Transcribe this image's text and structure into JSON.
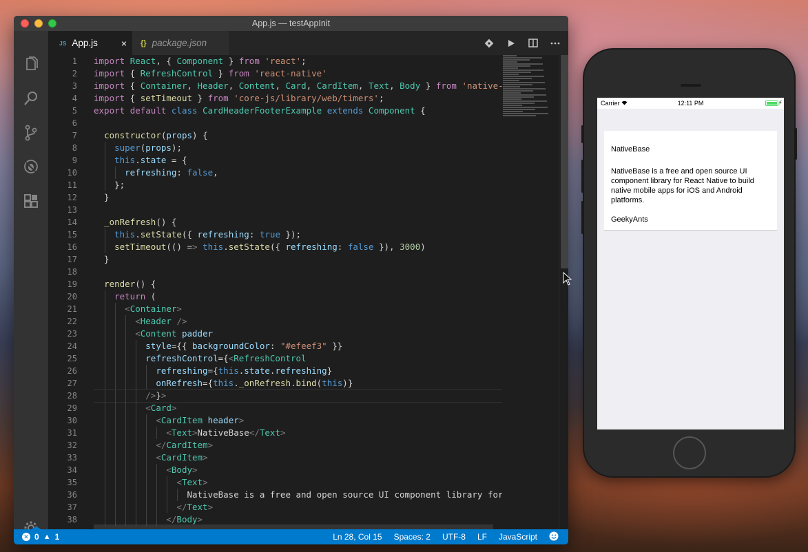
{
  "window": {
    "title": "App.js — testAppInit"
  },
  "tabs": [
    {
      "icon": "JS",
      "label": "App.js",
      "close": "×"
    },
    {
      "icon": "{}",
      "label": "package.json"
    }
  ],
  "activity_badge": "1",
  "line_numbers": [
    "1",
    "2",
    "3",
    "4",
    "5",
    "6",
    "7",
    "8",
    "9",
    "10",
    "11",
    "12",
    "13",
    "14",
    "15",
    "16",
    "17",
    "18",
    "19",
    "20",
    "21",
    "22",
    "23",
    "24",
    "25",
    "26",
    "27",
    "28",
    "29",
    "30",
    "31",
    "32",
    "33",
    "34",
    "35",
    "36",
    "37",
    "38"
  ],
  "code": [
    "import React, { Component } from 'react';",
    "import { RefreshControl } from 'react-native'",
    "import { Container, Header, Content, Card, CardItem, Text, Body } from 'native-bas",
    "import { setTimeout } from 'core-js/library/web/timers';",
    "export default class CardHeaderFooterExample extends Component {",
    "",
    "  constructor(props) {",
    "    super(props);",
    "    this.state = {",
    "      refreshing: false,",
    "    };",
    "  }",
    "",
    "  _onRefresh() {",
    "    this.setState({ refreshing: true });",
    "    setTimeout(() => this.setState({ refreshing: false }), 3000)",
    "  }",
    "",
    "  render() {",
    "    return (",
    "      <Container>",
    "        <Header />",
    "        <Content padder",
    "          style={{ backgroundColor: \"#efeef3\" }}",
    "          refreshControl={<RefreshControl",
    "            refreshing={this.state.refreshing}",
    "            onRefresh={this._onRefresh.bind(this)}",
    "          />}>",
    "          <Card>",
    "            <CardItem header>",
    "              <Text>NativeBase</Text>",
    "            </CardItem>",
    "            <CardItem>",
    "              <Body>",
    "                <Text>",
    "                  NativeBase is a free and open source UI component library for Re",
    "                </Text>",
    "              </Body>"
  ],
  "status": {
    "errors": "0",
    "warnings": "1",
    "position": "Ln 28, Col 15",
    "spaces": "Spaces: 2",
    "encoding": "UTF-8",
    "eol": "LF",
    "language": "JavaScript"
  },
  "phone": {
    "carrier": "Carrier",
    "time": "12:11 PM",
    "card_header": "NativeBase",
    "card_body": "NativeBase is a free and open source UI component library for React Native to build native mobile apps for iOS and Android platforms.",
    "card_footer": "GeekyAnts"
  },
  "colors": {
    "accent": "#007acc",
    "editor_bg": "#1e1e1e",
    "screen_bg": "#efeef3"
  }
}
